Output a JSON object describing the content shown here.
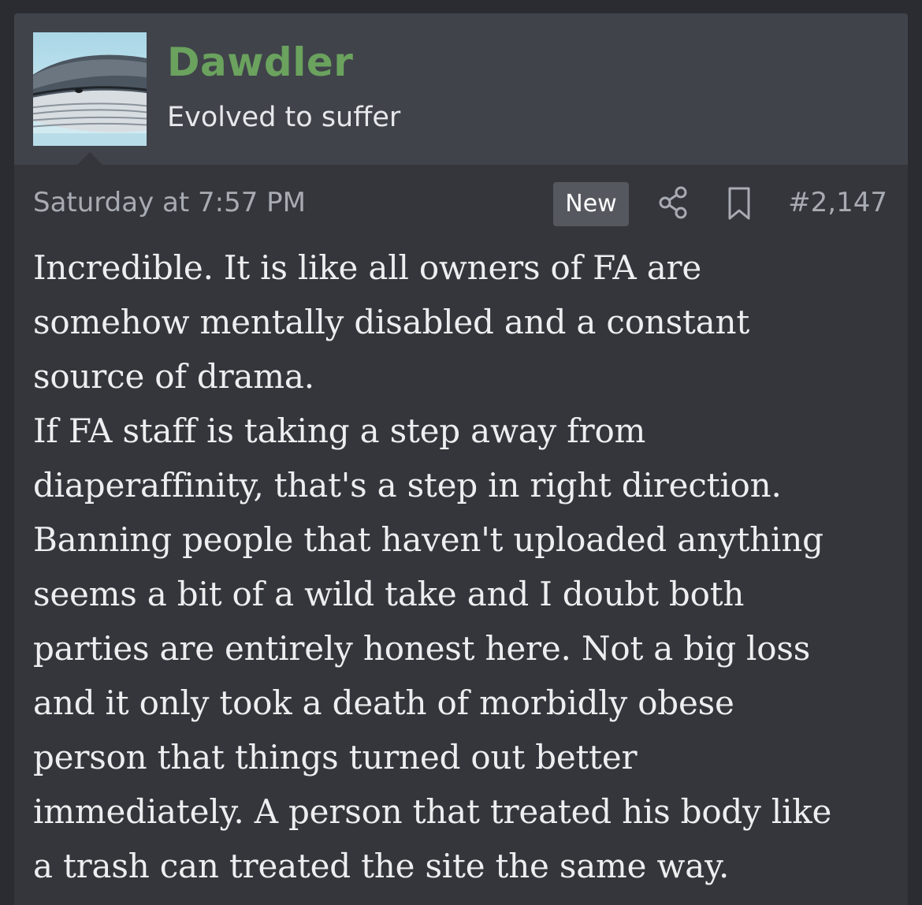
{
  "user": {
    "name": "Dawdler",
    "title": "Evolved to suffer",
    "avatar_icon": "whale-avatar-icon",
    "name_color": "#6aa25e"
  },
  "meta": {
    "date": "Saturday at 7:57 PM",
    "badge": "New",
    "share_icon": "share-icon",
    "bookmark_icon": "bookmark-icon",
    "post_number": "#2,147"
  },
  "message": {
    "lines": [
      "Incredible. It is like all owners of FA are",
      "somehow mentally disabled and a constant",
      "source of drama.",
      "If FA staff is taking a step away from",
      "diaperaffinity, that's a step in right direction.",
      "Banning people that haven't uploaded anything",
      "seems a bit of a wild take and I doubt both",
      "parties are entirely honest here. Not a big loss",
      "and it only took a death of morbidly obese",
      "person that things turned out better",
      "immediately. A person that treated his body like",
      "a trash can treated the site the same way."
    ]
  }
}
